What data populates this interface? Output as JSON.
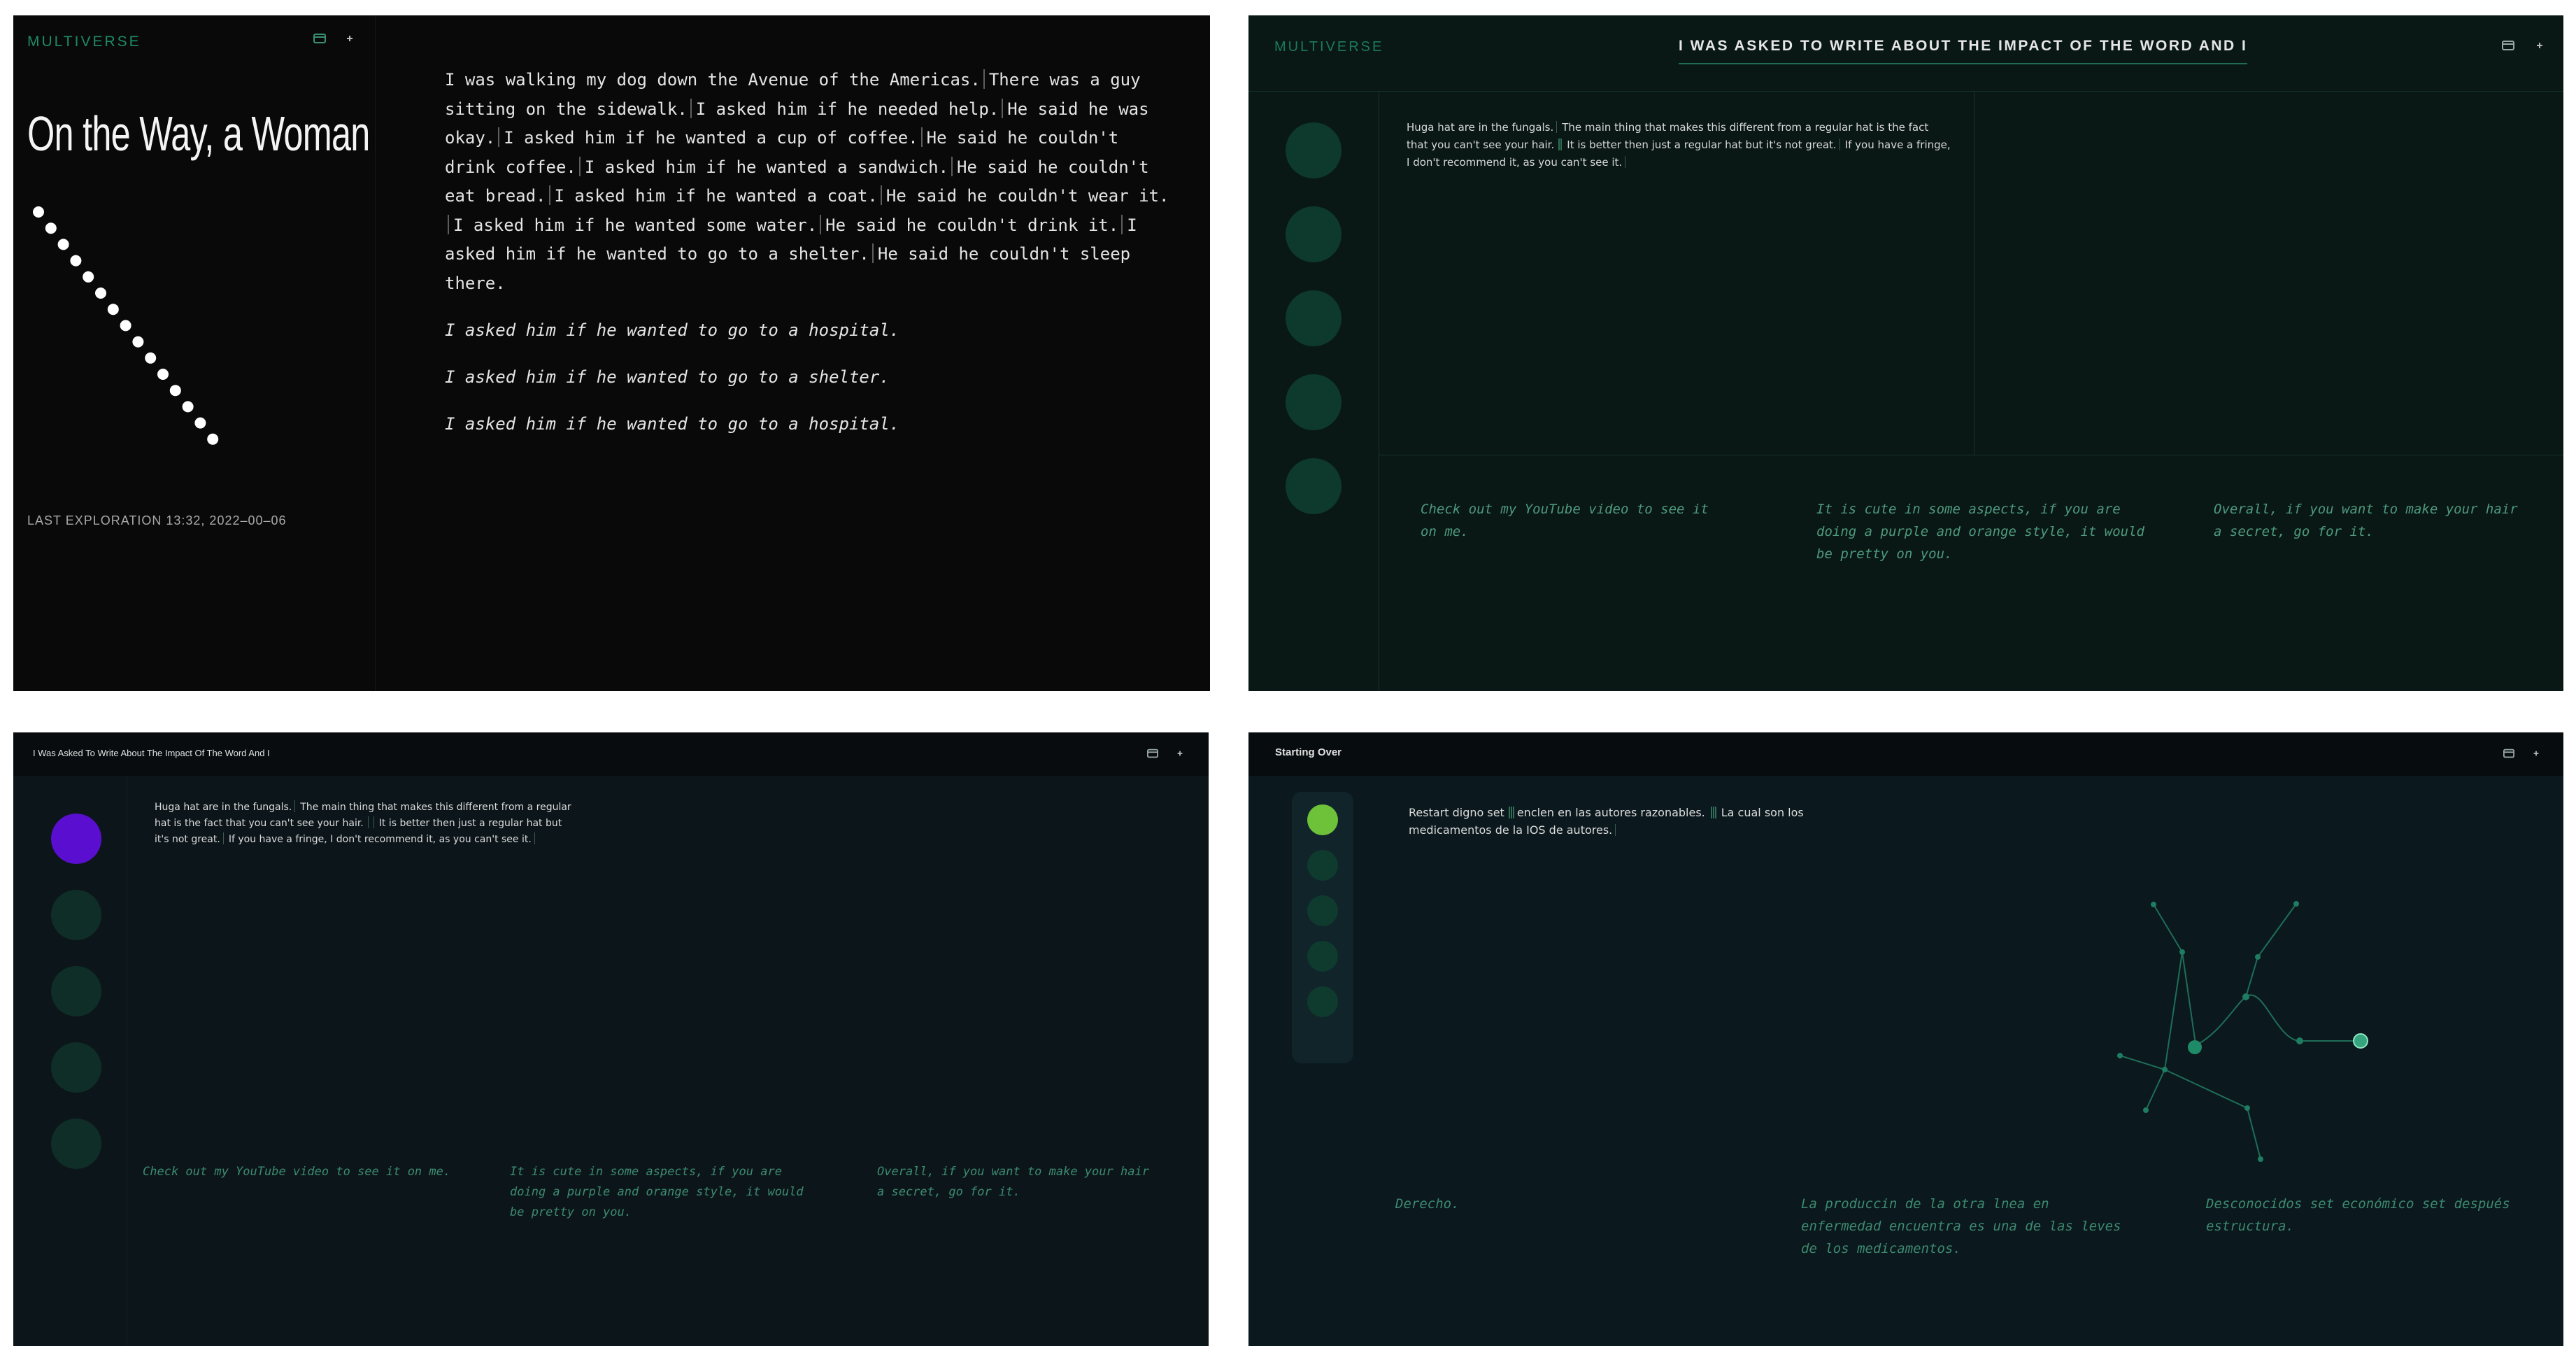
{
  "panel1": {
    "brand": "MULTIVERSE",
    "title": "On the Way, a Woman",
    "last_exploration": "LAST EXPLORATION 13:32, 2022–00–06",
    "paragraph_sentences": [
      "I was walking my dog down the Avenue of the Americas.",
      "There was a guy sitting on the sidewalk.",
      "I asked him if he needed help.",
      "He said he was okay.",
      "I asked him if he wanted a cup of coffee.",
      "He said he couldn't drink coffee.",
      "I asked him if he wanted a sandwich.",
      "He said he couldn't eat bread.",
      "I asked him if he wanted a coat.",
      "He said he couldn't wear it.",
      "I asked him if he wanted some water.",
      "He said he couldn't drink it.",
      "I asked him if he wanted to go to a shelter.",
      "He said he couldn't sleep there."
    ],
    "italic_lines": [
      "I asked him if he wanted to go to a hospital.",
      "I asked him if he wanted to go to a shelter.",
      "I asked him if he wanted to go to a hospital."
    ],
    "dots_count": 15
  },
  "panel2": {
    "brand": "MULTIVERSE",
    "heading": "I WAS ASKED TO WRITE ABOUT THE IMPACT OF THE WORD AND I",
    "message": {
      "s1": "Huga hat are in the fungals.",
      "s2": "The main thing that makes this different from a regular hat is the fact that you can't see your hair.",
      "s3": "It is better then just a regular hat but it's not great.",
      "s4": "If you have a fringe, I don't recommend it, as you can't see it."
    },
    "captions": [
      "Check out my YouTube video to see it on me.",
      "It is cute in some aspects, if you are doing a purple and orange style, it would be pretty on you.",
      "Overall, if you want to make your hair a secret, go for it."
    ]
  },
  "panel3": {
    "heading": "I Was Asked To Write About The Impact Of The Word And I",
    "message": {
      "s1": "Huga hat are in the fungals.",
      "s2": "The main thing that makes this different from a regular hat is the fact that you can't see your hair.",
      "s3": "It is better then just a regular hat but it's not great.",
      "s4": "If you have a fringe, I don't recommend it, as you can't see it."
    },
    "captions": [
      "Check out my YouTube video to see it on me.",
      "It is cute in some aspects, if you are doing a purple and orange style, it would be pretty on you.",
      "Overall, if you want to make your hair a secret, go for it."
    ]
  },
  "panel4": {
    "heading": "Starting Over",
    "message": {
      "s1": "Restart digno set",
      "s2": "enclen en las autores razonables.",
      "s3": "La cual son los medicamentos de la IOS de autores."
    },
    "captions": [
      "Derecho.",
      "La produccin de la otra lnea en enfermedad encuentra es una de las leves de los medicamentos.",
      "Desconocidos set económico set después estructura."
    ]
  },
  "colors": {
    "accent_green": "#1f8a67",
    "active_purple": "#5a0fd0",
    "active_green": "#6ec23a"
  },
  "icons": [
    "book-icon",
    "plus-icon"
  ]
}
